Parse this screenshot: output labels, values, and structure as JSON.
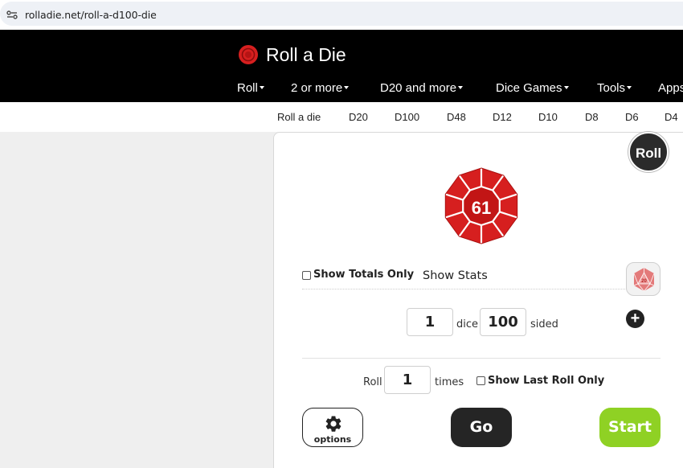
{
  "browser": {
    "url": "rolladie.net/roll-a-d100-die",
    "site_info_icon": "tune-icon"
  },
  "header": {
    "logo_icon": "red-die-logo-icon",
    "title": "Roll a Die",
    "nav": [
      {
        "label": "Roll",
        "dropdown": true
      },
      {
        "label": "2 or more",
        "dropdown": true
      },
      {
        "label": "D20 and more",
        "dropdown": true
      },
      {
        "label": "Dice Games",
        "dropdown": true
      },
      {
        "label": "Tools",
        "dropdown": true
      },
      {
        "label": "Apps",
        "dropdown": false
      }
    ]
  },
  "subnav": [
    "Roll a die",
    "D20",
    "D100",
    "D48",
    "D12",
    "D10",
    "D8",
    "D6",
    "D4"
  ],
  "roller": {
    "roll_button": "Roll",
    "die_result": "61",
    "die_color": "#d61f1f",
    "show_totals_label": "Show Totals Only",
    "show_totals_checked": false,
    "show_stats_label": "Show Stats",
    "d20_icon_label": "20",
    "dice_count": "1",
    "dice_label": "dice",
    "sides": "100",
    "sided_label": "sided",
    "add_icon": "plus-circle-icon",
    "roll_label": "Roll",
    "roll_times": "1",
    "times_label": "times",
    "show_last_label": "Show Last Roll Only",
    "show_last_checked": false,
    "options_label": "options",
    "go_label": "Go",
    "start_label": "Start",
    "start_color": "#8fd124"
  }
}
